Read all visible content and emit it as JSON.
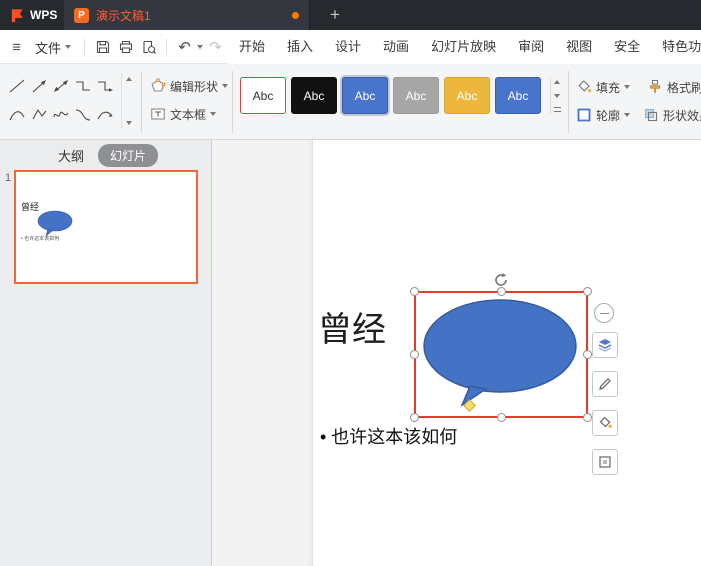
{
  "titlebar": {
    "app_name": "WPS",
    "doc_tab_title": "演示文稿1",
    "doc_icon_letter": "P",
    "new_tab_label": "+"
  },
  "icons": {
    "hamburger": "≡",
    "undo": "↶",
    "redo": "↷"
  },
  "menubar": {
    "file_label": "文件",
    "menus": [
      "开始",
      "插入",
      "设计",
      "动画",
      "幻灯片放映",
      "审阅",
      "视图",
      "安全",
      "特色功能"
    ]
  },
  "toolbar": {
    "edit_shape_label": "编辑形状",
    "textbox_label": "文本框",
    "shape_styles": [
      {
        "label": "Abc",
        "style": "background:#ffffff;color:#333333;border:1px solid #c0504d"
      },
      {
        "label": "Abc",
        "style": "background:#111111;color:#ffffff;border:1px solid #111111"
      },
      {
        "label": "Abc",
        "style": "background:#4874cb;color:#ffffff;border:1px solid #3a5ea6;box-shadow:0 0 0 2px #c2c9d4"
      },
      {
        "label": "Abc",
        "style": "background:#a6a6a6;color:#ffffff;border:1px solid #9a9a9a"
      },
      {
        "label": "Abc",
        "style": "background:#edb73e;color:#ffffff;border:1px solid #d9a52f"
      },
      {
        "label": "Abc",
        "style": "background:#4874cb;color:#ffffff;border:1px solid #3a5ea6"
      }
    ],
    "fill_label": "填充",
    "outline_label": "轮廓",
    "format_painter_label": "格式刷",
    "shape_effects_label": "形状效果"
  },
  "panel": {
    "outline_tab_label": "大纲",
    "slides_tab_label": "幻灯片",
    "slide_number": "1",
    "thumbnail": {
      "title": "曾经",
      "bullet": "• 也许这本该如何"
    }
  },
  "slide": {
    "title": "曾经",
    "bullet": "• 也许这本该如何"
  },
  "colors": {
    "selection_red": "#e23c2c",
    "shape_fill": "#4472c4",
    "shape_outline": "#35599c",
    "accent_orange": "#ea6b3a"
  }
}
